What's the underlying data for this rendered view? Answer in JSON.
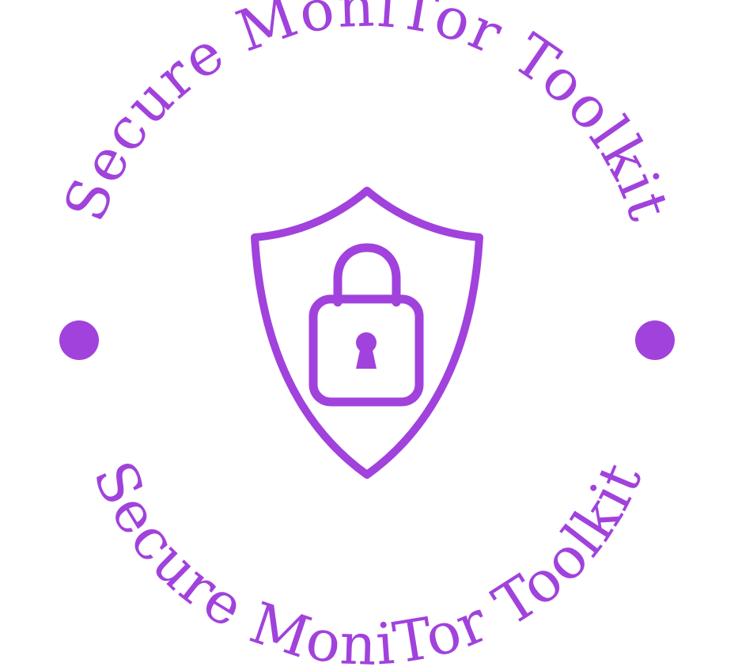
{
  "logo": {
    "top_text": "Secure MoniTor Toolkit",
    "bottom_text": "Secure MoniTor Toolkit",
    "accent_color": "#a142dc",
    "background_color": "#ffffff",
    "icon": "shield-lock-icon"
  }
}
